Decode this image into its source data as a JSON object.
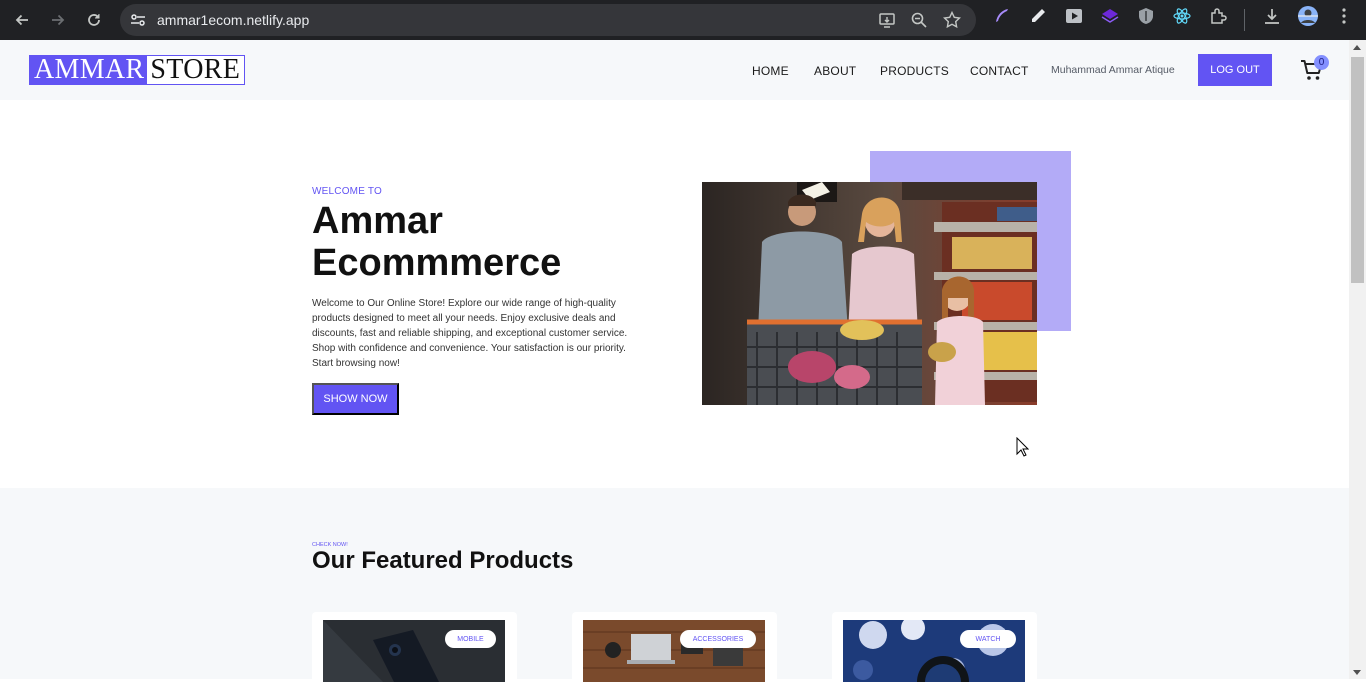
{
  "browser": {
    "url": "ammar1ecom.netlify.app",
    "icons": [
      "back-icon",
      "forward-icon",
      "reload-icon",
      "site-info-icon",
      "install-app-icon",
      "zoom-icon",
      "bookmark-star-icon",
      "extensions-icon",
      "download-icon",
      "profile-avatar",
      "menu-icon"
    ]
  },
  "header": {
    "logo_part1": "AMMAR",
    "logo_part2": "STORE",
    "nav": [
      "HOME",
      "ABOUT",
      "PRODUCTS",
      "CONTACT"
    ],
    "user_name": "Muhammad Ammar Atique",
    "logout_label": "LOG OUT",
    "cart_count": "0"
  },
  "hero": {
    "eyebrow": "WELCOME TO",
    "title": "Ammar Ecommmerce",
    "description": "Welcome to Our Online Store! Explore our wide range of high-quality products designed to meet all your needs. Enjoy exclusive deals and discounts, fast and reliable shipping, and exceptional customer service. Shop with confidence and convenience. Your satisfaction is our priority. Start browsing now!",
    "cta_label": "SHOW NOW"
  },
  "featured": {
    "eyebrow": "CHECK NOW!",
    "title": "Our Featured Products",
    "products": [
      {
        "category": "MOBILE"
      },
      {
        "category": "ACCESSORIES"
      },
      {
        "category": "WATCH"
      }
    ]
  },
  "colors": {
    "accent": "#6254f3",
    "accent_light": "#b3abf7",
    "section_bg": "#f6f8fa"
  }
}
